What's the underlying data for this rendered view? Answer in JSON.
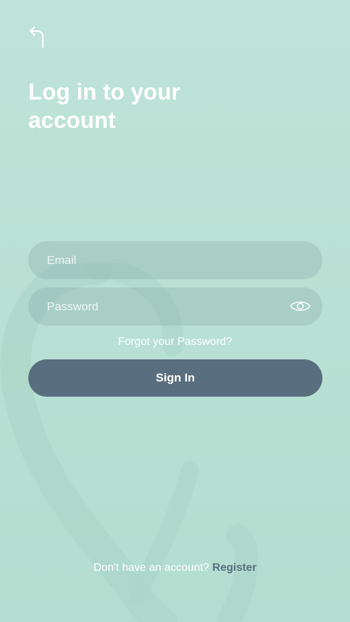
{
  "header": {
    "back_icon": "back-arrow-icon",
    "title": "Log in to your account"
  },
  "form": {
    "email_placeholder": "Email",
    "password_placeholder": "Password",
    "eye_icon": "eye-icon",
    "forgot_label": "Forgot your Password?",
    "signin_label": "Sign In"
  },
  "footer": {
    "prompt": "Don't have an account?",
    "register_label": "Register"
  },
  "colors": {
    "background": "#bce2d6",
    "button": "#596e7f",
    "text": "#ffffff"
  }
}
